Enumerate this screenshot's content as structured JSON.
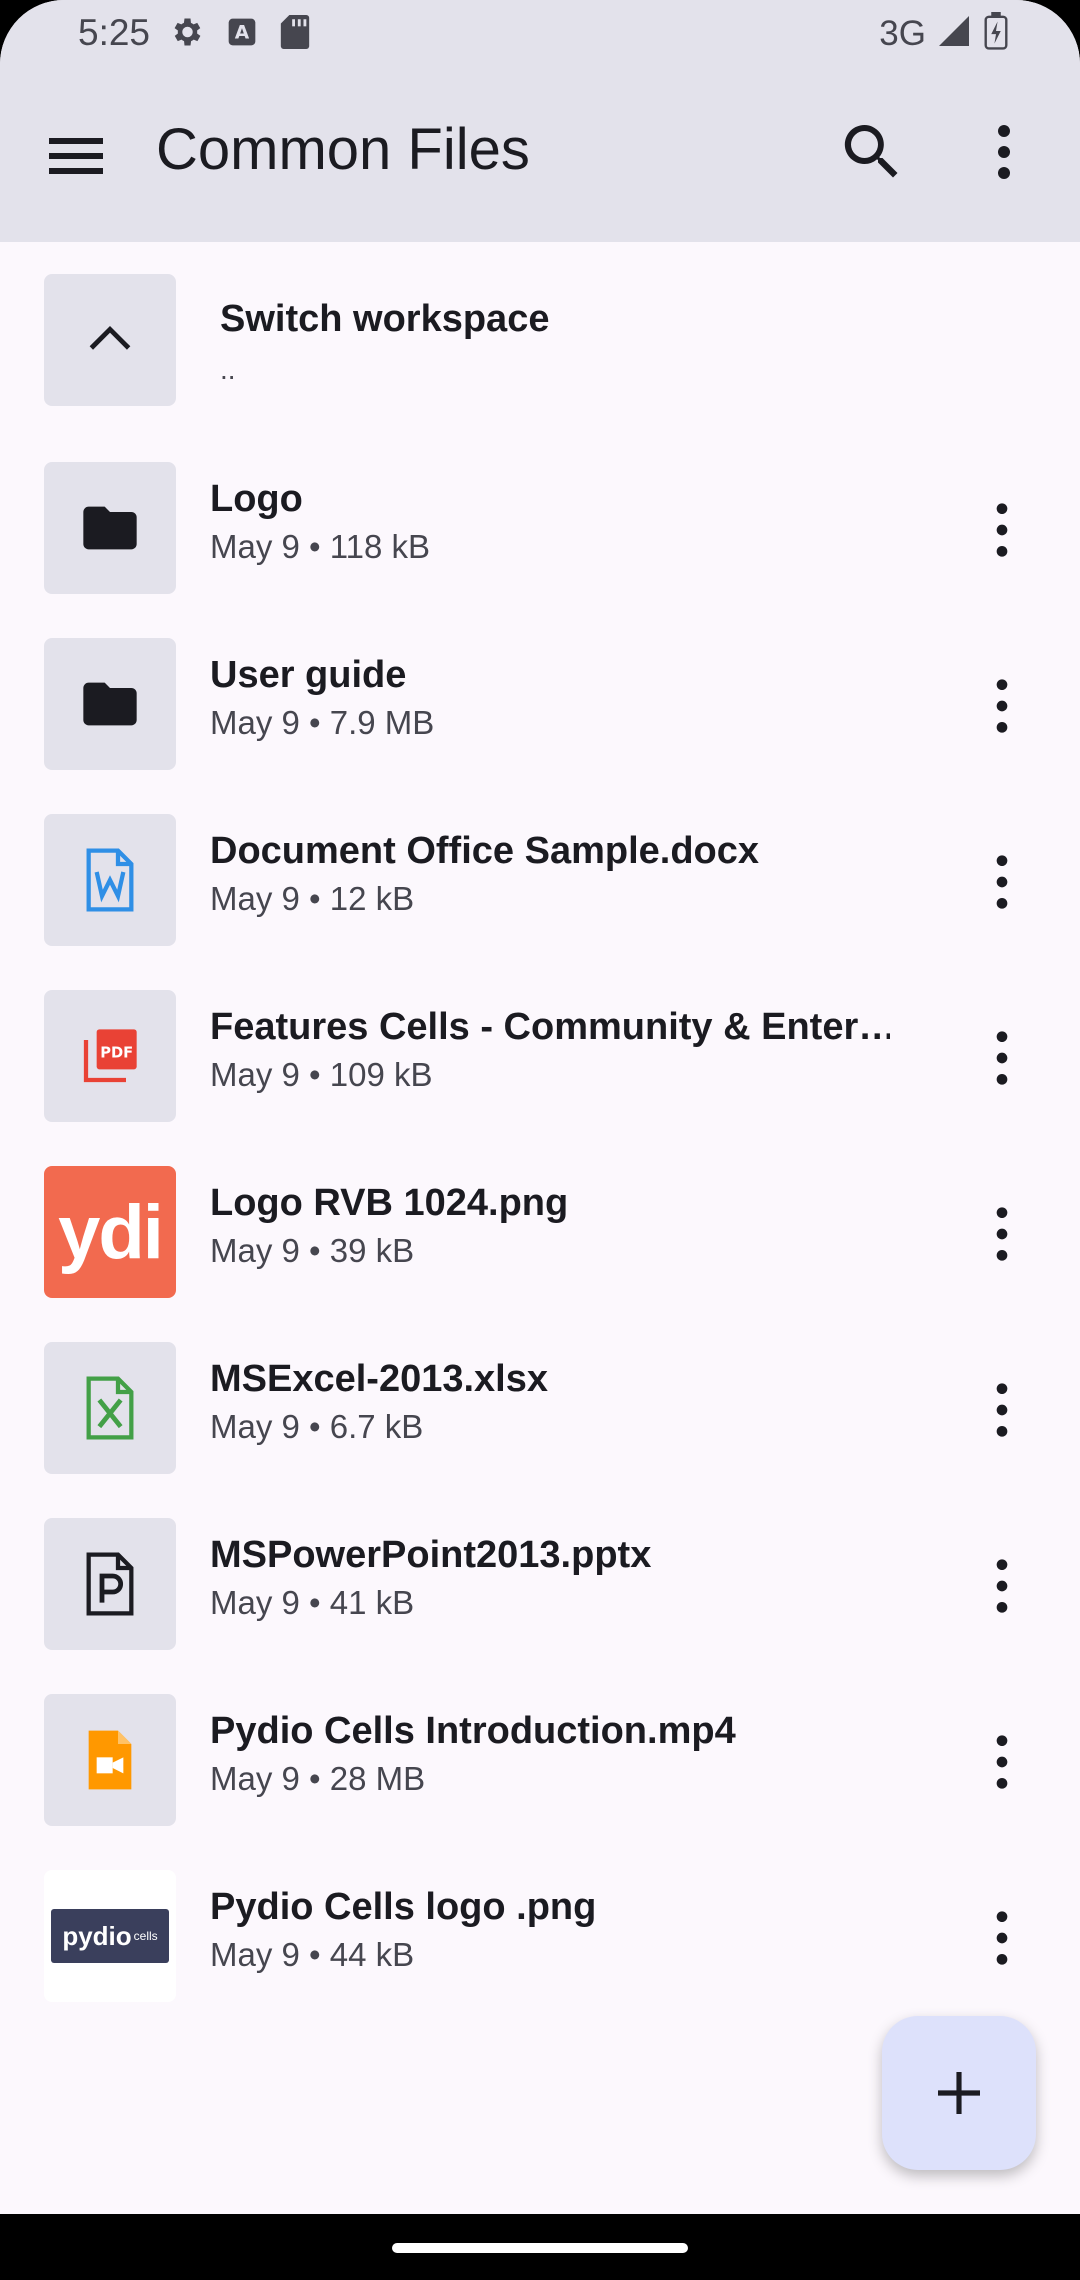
{
  "status_bar": {
    "time": "5:25",
    "network": "3G",
    "icons": [
      "settings-icon",
      "accessibility-a-icon",
      "sd-card-icon",
      "signal-icon",
      "battery-icon"
    ]
  },
  "app_bar": {
    "title": "Common Files",
    "icons": [
      "menu-icon",
      "search-icon",
      "more-vert-icon"
    ]
  },
  "switch_workspace": {
    "title": "Switch workspace",
    "subtitle": ".."
  },
  "files": [
    {
      "name": "Logo",
      "meta": "May 9 • 118 kB",
      "icon": "folder-icon"
    },
    {
      "name": "User guide",
      "meta": "May 9 • 7.9 MB",
      "icon": "folder-icon"
    },
    {
      "name": "Document Office Sample.docx",
      "meta": "May 9 • 12 kB",
      "icon": "word-doc-icon"
    },
    {
      "name": "Features Cells - Community & Enter…",
      "meta": "May 9 • 109 kB",
      "icon": "pdf-icon"
    },
    {
      "name": "Logo RVB 1024.png",
      "meta": "May 9 • 39 kB",
      "icon": "image-thumbnail"
    },
    {
      "name": "MSExcel-2013.xlsx",
      "meta": "May 9 • 6.7 kB",
      "icon": "excel-icon"
    },
    {
      "name": "MSPowerPoint2013.pptx",
      "meta": "May 9 • 41 kB",
      "icon": "powerpoint-icon"
    },
    {
      "name": "Pydio Cells Introduction.mp4",
      "meta": "May 9 • 28 MB",
      "icon": "video-icon"
    },
    {
      "name": "Pydio Cells logo .png",
      "meta": "May 9 • 44 kB",
      "icon": "image-thumbnail"
    }
  ],
  "thumb_text": {
    "logo_rvb": "ydi",
    "cells_logo": "pydio",
    "cells_logo_small": "cells"
  },
  "fab": {
    "icon": "plus-icon"
  },
  "colors": {
    "app_bar_bg": "#e3e2eb",
    "surface": "#fcf8fd",
    "fab_bg": "#dde1fb",
    "word_blue": "#2f8fe6",
    "pdf_red": "#e94235",
    "excel_green": "#43a047",
    "video_orange": "#ff9800",
    "pydio_orange": "#f26a4f"
  }
}
